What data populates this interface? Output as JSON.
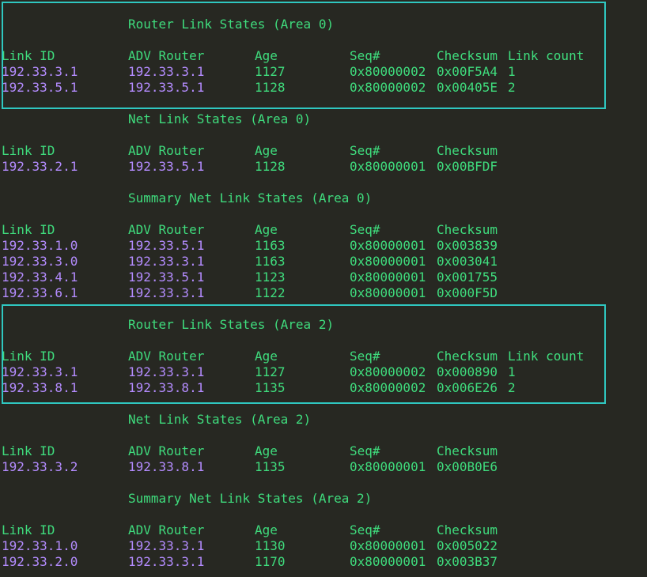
{
  "colors": {
    "background": "#272822",
    "header_text": "#3fdc7d",
    "value_text": "#b48cff",
    "highlight_border": "#2fc7c0"
  },
  "sections": [
    {
      "title": "Router Link States (Area 0)",
      "headers": [
        "Link ID",
        "ADV Router",
        "Age",
        "Seq#",
        "Checksum",
        "Link count"
      ],
      "rows": [
        [
          "192.33.3.1",
          "192.33.3.1",
          "1127",
          "0x80000002",
          "0x00F5A4",
          "1"
        ],
        [
          "192.33.5.1",
          "192.33.5.1",
          "1128",
          "0x80000002",
          "0x00405E",
          "2"
        ]
      ]
    },
    {
      "title": "Net Link States (Area 0)",
      "headers": [
        "Link ID",
        "ADV Router",
        "Age",
        "Seq#",
        "Checksum"
      ],
      "rows": [
        [
          "192.33.2.1",
          "192.33.5.1",
          "1128",
          "0x80000001",
          "0x00BFDF"
        ]
      ]
    },
    {
      "title": "Summary Net Link States (Area 0)",
      "headers": [
        "Link ID",
        "ADV Router",
        "Age",
        "Seq#",
        "Checksum"
      ],
      "rows": [
        [
          "192.33.1.0",
          "192.33.5.1",
          "1163",
          "0x80000001",
          "0x003839"
        ],
        [
          "192.33.3.0",
          "192.33.3.1",
          "1163",
          "0x80000001",
          "0x003041"
        ],
        [
          "192.33.4.1",
          "192.33.5.1",
          "1123",
          "0x80000001",
          "0x001755"
        ],
        [
          "192.33.6.1",
          "192.33.3.1",
          "1122",
          "0x80000001",
          "0x000F5D"
        ]
      ]
    },
    {
      "title": "Router Link States (Area 2)",
      "headers": [
        "Link ID",
        "ADV Router",
        "Age",
        "Seq#",
        "Checksum",
        "Link count"
      ],
      "rows": [
        [
          "192.33.3.1",
          "192.33.3.1",
          "1127",
          "0x80000002",
          "0x000890",
          "1"
        ],
        [
          "192.33.8.1",
          "192.33.8.1",
          "1135",
          "0x80000002",
          "0x006E26",
          "2"
        ]
      ]
    },
    {
      "title": "Net Link States (Area 2)",
      "headers": [
        "Link ID",
        "ADV Router",
        "Age",
        "Seq#",
        "Checksum"
      ],
      "rows": [
        [
          "192.33.3.2",
          "192.33.8.1",
          "1135",
          "0x80000001",
          "0x00B0E6"
        ]
      ]
    },
    {
      "title": "Summary Net Link States (Area 2)",
      "headers": [
        "Link ID",
        "ADV Router",
        "Age",
        "Seq#",
        "Checksum"
      ],
      "rows": [
        [
          "192.33.1.0",
          "192.33.3.1",
          "1130",
          "0x80000001",
          "0x005022"
        ],
        [
          "192.33.2.0",
          "192.33.3.1",
          "1170",
          "0x80000001",
          "0x003B37"
        ]
      ]
    }
  ]
}
